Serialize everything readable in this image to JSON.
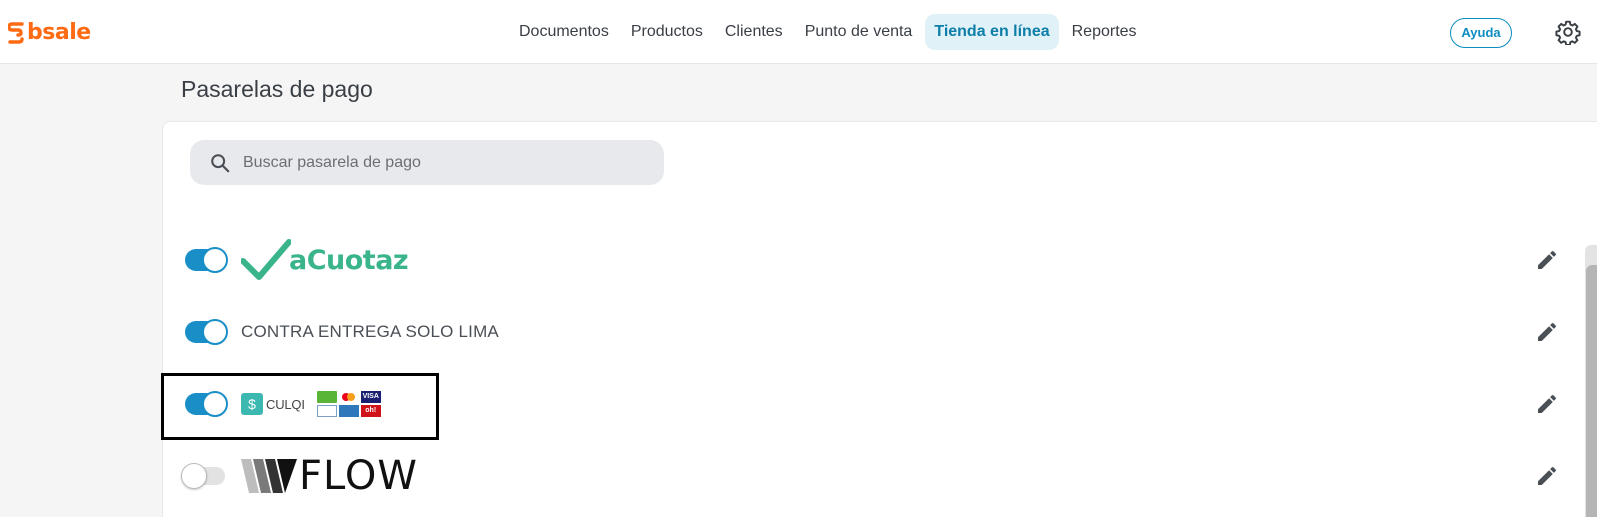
{
  "brand": {
    "name": "bsale",
    "color": "#ff6a13"
  },
  "nav": {
    "items": [
      {
        "label": "Documentos",
        "active": false
      },
      {
        "label": "Productos",
        "active": false
      },
      {
        "label": "Clientes",
        "active": false
      },
      {
        "label": "Punto de venta",
        "active": false
      },
      {
        "label": "Tienda en línea",
        "active": true
      },
      {
        "label": "Reportes",
        "active": false
      }
    ],
    "help_label": "Ayuda",
    "settings_icon": "gear-icon"
  },
  "page": {
    "title": "Pasarelas de pago"
  },
  "search": {
    "placeholder": "Buscar pasarela de pago",
    "value": "",
    "icon": "search-icon"
  },
  "gateways": [
    {
      "name": "aCuotaz",
      "enabled": true,
      "display": "logo"
    },
    {
      "name": "CONTRA ENTREGA SOLO LIMA",
      "enabled": true,
      "display": "text"
    },
    {
      "name": "CULQI",
      "enabled": true,
      "display": "logo",
      "card_badges": [
        "CMR",
        "Mastercard",
        "VISA",
        "Diners",
        "American Express",
        "oh!"
      ]
    },
    {
      "name": "FLOW",
      "enabled": false,
      "display": "logo"
    }
  ],
  "colors": {
    "accent": "#1a8fc7",
    "active_nav_bg": "#e1f1f8",
    "acuotaz_green": "#3ab48a"
  }
}
